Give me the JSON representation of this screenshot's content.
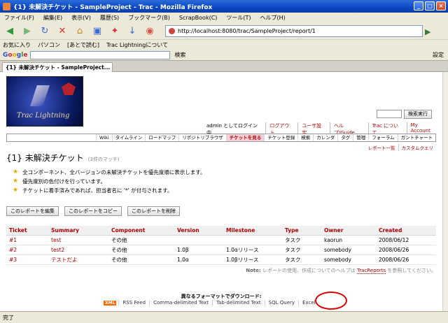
{
  "window": {
    "title": "{1} 未解決チケット - SampleProject - Trac - Mozilla Firefox"
  },
  "menu": [
    "ファイル(F)",
    "編集(E)",
    "表示(V)",
    "履歴(S)",
    "ブックマーク(B)",
    "ScrapBook(C)",
    "ツール(T)",
    "ヘルプ(H)"
  ],
  "nav": {
    "url": "http://localhost:8080/trac/SampleProject/report/1"
  },
  "bookmarks": [
    "お気に入り",
    "パソコン",
    "[あとで読む]",
    "Trac Lightningについて"
  ],
  "google": {
    "search_label": "検索",
    "settings_label": "設定"
  },
  "tab": {
    "label": "{1} 未解決チケット - SampleProject..."
  },
  "logo": {
    "text": "Trac Lightning"
  },
  "search": {
    "button": "検索実行"
  },
  "metanav": [
    "admin としてログイン中",
    "ログアウト",
    "ユーザ設定",
    "ヘルプ/Guide",
    "Trac について",
    "My Account"
  ],
  "mainnav": [
    "Wiki",
    "タイムライン",
    "ロードマップ",
    "リポジトリブラウザ",
    "チケットを見る",
    "チケット登録",
    "検索",
    "カレンダ",
    "タグ",
    "管理",
    "フォーラム",
    "ガントチャート"
  ],
  "ctxnav": [
    "レポート一覧",
    "カスタムクエリ"
  ],
  "report": {
    "title": "{1} 未解決チケット",
    "count": "(3件のマッチ)",
    "desc": [
      "全コンポーネント、全バージョンの未解決チケットを優先度順に表示します。",
      "優先度別の色付けを行っています。",
      "チケットに着手済みであれば、担当者名に '*' が付与されます。"
    ],
    "buttons": [
      "このレポートを編集",
      "このレポートをコピー",
      "このレポートを削除"
    ],
    "columns": [
      "Ticket",
      "Summary",
      "Component",
      "Version",
      "Milestone",
      "Type",
      "Owner",
      "Created"
    ],
    "rows": [
      [
        "#1",
        "test",
        "その他",
        "",
        "",
        "タスク",
        "kaorun",
        "2008/06/12"
      ],
      [
        "#2",
        "test2",
        "その他",
        "1.0β",
        "1.0αリリース",
        "タスク",
        "somebody",
        "2008/06/26"
      ],
      [
        "#3",
        "テストだよ",
        "その他",
        "1.0α",
        "1.0βリリース",
        "タスク",
        "somebody",
        "2008/06/26"
      ]
    ],
    "note_label": "Note:",
    "note_text": "レポートの使用、作成についてのヘルプは",
    "note_link": "TracReports",
    "note_tail": "を参照してください。"
  },
  "download": {
    "heading": "異なるフォーマットでダウンロード:",
    "xml_badge": "XML",
    "formats": [
      "RSS Feed",
      "Comma-delimited Text",
      "Tab-delimited Text",
      "SQL Query",
      "Excel"
    ]
  },
  "status": {
    "text": "完了"
  }
}
